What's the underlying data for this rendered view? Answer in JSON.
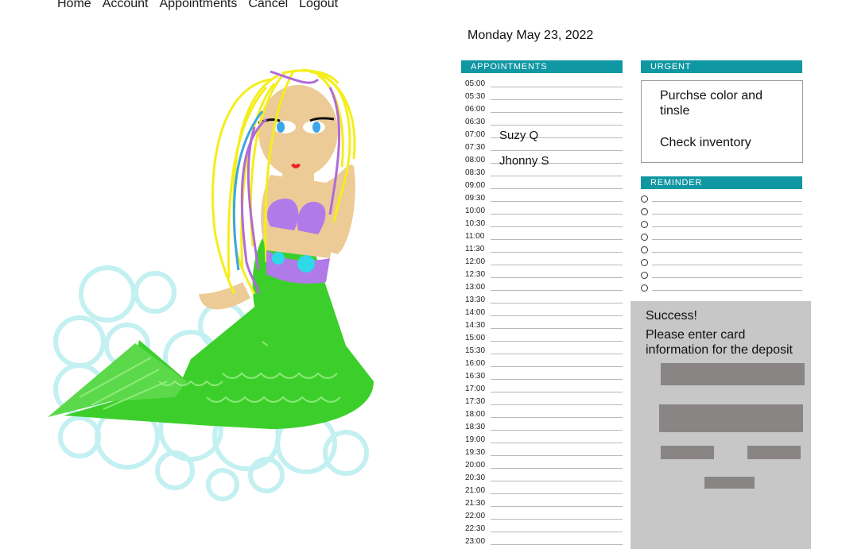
{
  "nav": {
    "items": [
      "Home",
      "Account",
      "Appointments",
      "Cancel",
      "Logout"
    ]
  },
  "date_heading": "Monday May 23, 2022",
  "appointments": {
    "title": "APPOINTMENTS",
    "slots": [
      {
        "time": "05:00",
        "name": ""
      },
      {
        "time": "05:30",
        "name": ""
      },
      {
        "time": "06:00",
        "name": ""
      },
      {
        "time": "06:30",
        "name": ""
      },
      {
        "time": "07:00",
        "name": "Suzy Q"
      },
      {
        "time": "07:30",
        "name": ""
      },
      {
        "time": "08:00",
        "name": "Jhonny S"
      },
      {
        "time": "08:30",
        "name": ""
      },
      {
        "time": "09:00",
        "name": ""
      },
      {
        "time": "09:30",
        "name": ""
      },
      {
        "time": "10:00",
        "name": ""
      },
      {
        "time": "10:30",
        "name": ""
      },
      {
        "time": "11:00",
        "name": ""
      },
      {
        "time": "11:30",
        "name": ""
      },
      {
        "time": "12:00",
        "name": ""
      },
      {
        "time": "12:30",
        "name": ""
      },
      {
        "time": "13:00",
        "name": ""
      },
      {
        "time": "13:30",
        "name": ""
      },
      {
        "time": "14:00",
        "name": ""
      },
      {
        "time": "14:30",
        "name": ""
      },
      {
        "time": "15:00",
        "name": ""
      },
      {
        "time": "15:30",
        "name": ""
      },
      {
        "time": "16:00",
        "name": ""
      },
      {
        "time": "16:30",
        "name": ""
      },
      {
        "time": "17:00",
        "name": ""
      },
      {
        "time": "17:30",
        "name": ""
      },
      {
        "time": "18:00",
        "name": ""
      },
      {
        "time": "18:30",
        "name": ""
      },
      {
        "time": "19:00",
        "name": ""
      },
      {
        "time": "19:30",
        "name": ""
      },
      {
        "time": "20:00",
        "name": ""
      },
      {
        "time": "20:30",
        "name": ""
      },
      {
        "time": "21:00",
        "name": ""
      },
      {
        "time": "21:30",
        "name": ""
      },
      {
        "time": "22:00",
        "name": ""
      },
      {
        "time": "22:30",
        "name": ""
      },
      {
        "time": "23:00",
        "name": ""
      }
    ]
  },
  "urgent": {
    "title": "URGENT",
    "items": [
      "Purchse color and tinsle",
      "Check inventory"
    ]
  },
  "reminder": {
    "title": "REMINDER",
    "items": [
      "",
      "",
      "",
      "",
      "",
      "",
      "",
      ""
    ]
  },
  "payment": {
    "success": "Success!",
    "prompt": "Please enter card information for the deposit",
    "fields": [
      "",
      "",
      "",
      "",
      ""
    ]
  },
  "colors": {
    "accent": "#0f97a3",
    "panel_bg": "#c7c7c7",
    "field_bg": "#8a8585",
    "hair": "#f4ee1c",
    "tail": "#3ccf2b",
    "skin": "#eccb96",
    "shell": "#b07ae8",
    "bubble": "#bdeff0"
  },
  "illustration": {
    "icon": "mermaid-drawing-icon"
  }
}
